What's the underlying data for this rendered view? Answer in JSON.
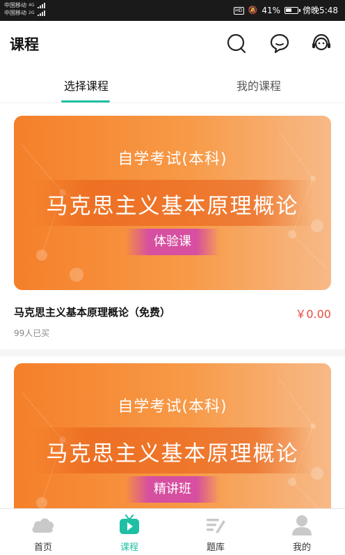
{
  "status_bar": {
    "carrier1": "中国移动",
    "carrier1_net": "4G",
    "carrier2": "中国移动",
    "carrier2_net": "2G",
    "battery": "41%",
    "time": "傍晚5:48",
    "icons": [
      "hd-icon",
      "mute-icon",
      "battery-icon"
    ]
  },
  "header": {
    "title": "课程",
    "icons": [
      "search-icon",
      "chat-icon",
      "customer-service-icon"
    ]
  },
  "tabs": [
    {
      "label": "选择课程",
      "active": true
    },
    {
      "label": "我的课程",
      "active": false
    }
  ],
  "courses": [
    {
      "banner_exam": "自学考试(本科)",
      "banner_course": "马克思主义基本原理概论",
      "banner_badge": "体验课",
      "name": "马克思主义基本原理概论（免费）",
      "price": "￥0.00",
      "buyers": "99人已买"
    },
    {
      "banner_exam": "自学考试(本科)",
      "banner_course": "马克思主义基本原理概论",
      "banner_badge": "精讲班"
    }
  ],
  "bottom_nav": [
    {
      "label": "首页",
      "icon": "home-cloud-icon",
      "active": false
    },
    {
      "label": "课程",
      "icon": "course-tv-icon",
      "active": true
    },
    {
      "label": "题库",
      "icon": "question-bank-icon",
      "active": false
    },
    {
      "label": "我的",
      "icon": "profile-icon",
      "active": false
    }
  ],
  "colors": {
    "accent": "#1fbfa3",
    "price": "#e84a3c",
    "banner_orange": "#f57f2a",
    "badge_pink": "#d64fa0"
  }
}
